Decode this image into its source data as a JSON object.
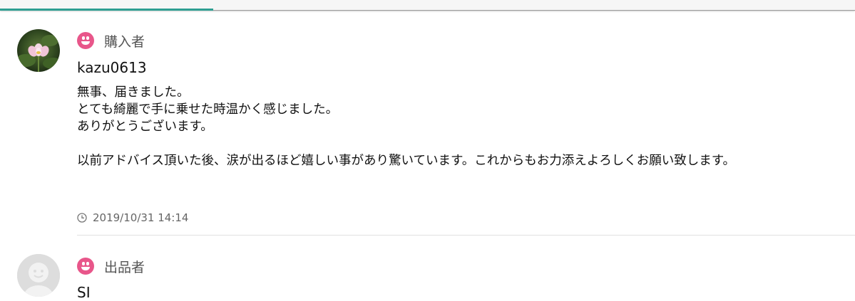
{
  "comments": [
    {
      "role": "購入者",
      "username": "kazu0613",
      "message": "無事、届きました。\nとても綺麗で手に乗せた時温かく感じました。\nありがとうございます。\n\n以前アドバイス頂いた後、涙が出るほど嬉しい事があり驚いています。これからもお力添えよろしくお願い致します。",
      "timestamp": "2019/10/31 14:14"
    },
    {
      "role": "出品者",
      "username": "SI"
    }
  ],
  "icons": {
    "role": "smiley-face-icon",
    "timestamp": "clock-icon",
    "avatar_buyer": "lotus-flower-photo",
    "avatar_seller": "default-user-icon"
  },
  "colors": {
    "accent_tab": "#2e9e92",
    "role_icon": "#e8568a"
  }
}
